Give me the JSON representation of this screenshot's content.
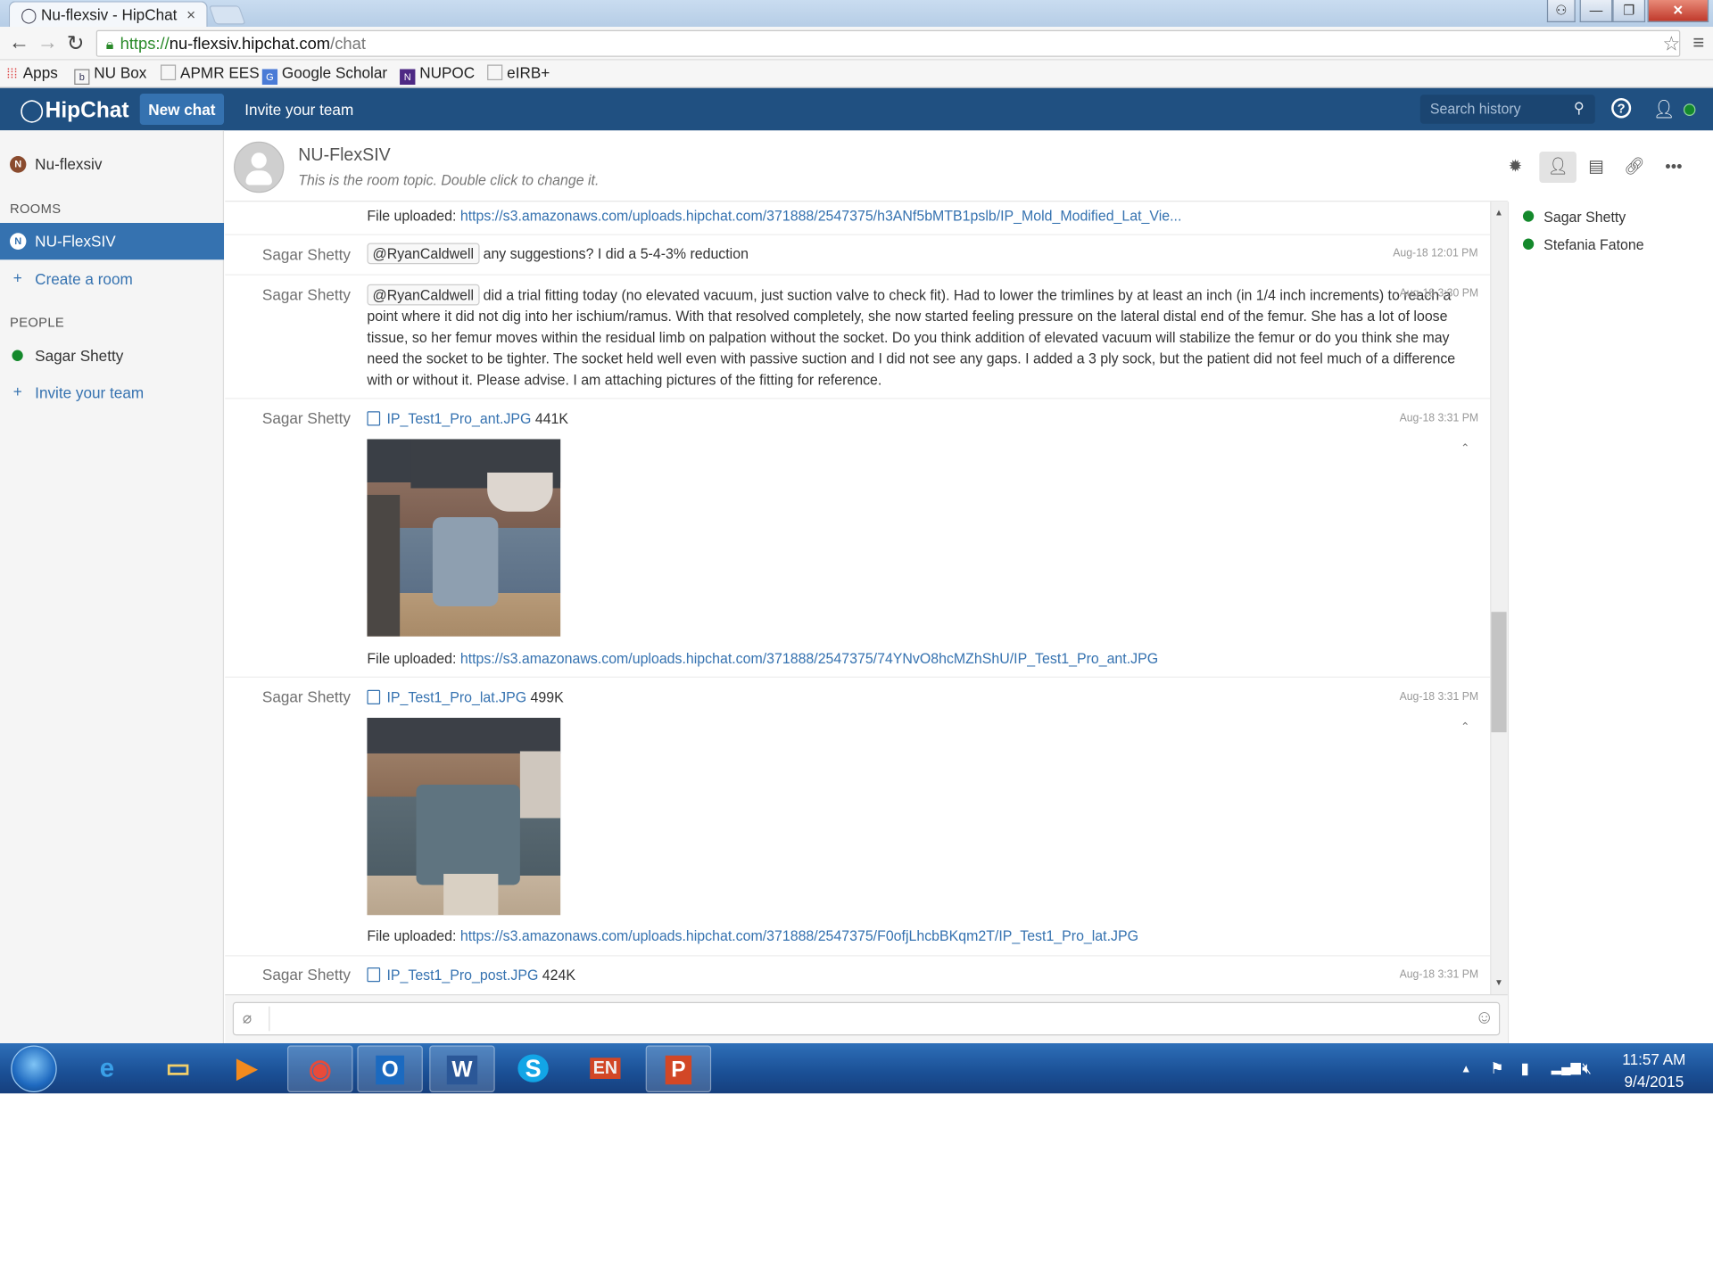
{
  "browser": {
    "tab_title": "Nu-flexsiv - HipChat",
    "url_scheme": "https://",
    "url_host": "nu-flexsiv.hipchat.com",
    "url_path": "/chat",
    "bookmarks": [
      "Apps",
      "NU Box",
      "APMR EES",
      "Google Scholar",
      "NUPOC",
      "eIRB+"
    ]
  },
  "header": {
    "logo": "HipChat",
    "new_chat": "New chat",
    "invite": "Invite your team",
    "search_placeholder": "Search history"
  },
  "sidebar": {
    "group_name": "Nu-flexsiv",
    "rooms_heading": "ROOMS",
    "active_room": "NU-FlexSIV",
    "create_room": "Create a room",
    "people_heading": "PEOPLE",
    "person": "Sagar Shetty",
    "invite_team": "Invite your team"
  },
  "room": {
    "title": "NU-FlexSIV",
    "topic": "This is the room topic. Double click to change it."
  },
  "messages": {
    "m0": {
      "prefix": "File uploaded: ",
      "link": "https://s3.amazonaws.com/uploads.hipchat.com/371888/2547375/h3ANf5bMTB1pslb/IP_Mold_Modified_Lat_Vie..."
    },
    "m1": {
      "sender": "Sagar Shetty",
      "mention": "@RyanCaldwell",
      "text": " any suggestions? I did a 5-4-3% reduction",
      "time": "Aug-18 12:01 PM"
    },
    "m2": {
      "sender": "Sagar Shetty",
      "mention": "@RyanCaldwell",
      "text": " did a trial fitting today (no elevated vacuum, just suction valve to check fit). Had to lower the trimlines by at least an inch (in 1/4 inch increments) to reach a point where it did not dig into her ischium/ramus. With that resolved completely, she now started feeling pressure on the lateral distal end of the femur. She has a lot of loose tissue, so her femur moves within the residual limb on palpation without the socket. Do you think addition of elevated vacuum will stabilize the femur or do you think she may need the socket to be tighter. The socket held well even with passive suction and I did not see any gaps. I added a 3 ply sock, but the patient did not feel much of a difference with or without it. Please advise. I am attaching pictures of the fitting for reference.",
      "time": "Aug-18 3:30 PM"
    },
    "m3": {
      "sender": "Sagar Shetty",
      "file_name": "IP_Test1_Pro_ant.JPG",
      "file_size": "441K",
      "time": "Aug-18 3:31 PM",
      "upload_prefix": "File uploaded: ",
      "upload_link": "https://s3.amazonaws.com/uploads.hipchat.com/371888/2547375/74YNvO8hcMZhShU/IP_Test1_Pro_ant.JPG"
    },
    "m4": {
      "sender": "Sagar Shetty",
      "file_name": "IP_Test1_Pro_lat.JPG",
      "file_size": "499K",
      "time": "Aug-18 3:31 PM",
      "upload_prefix": "File uploaded: ",
      "upload_link": "https://s3.amazonaws.com/uploads.hipchat.com/371888/2547375/F0ofjLhcbBKqm2T/IP_Test1_Pro_lat.JPG"
    },
    "m5": {
      "sender": "Sagar Shetty",
      "file_name": "IP_Test1_Pro_post.JPG",
      "file_size": "424K",
      "time": "Aug-18 3:31 PM"
    }
  },
  "roster": [
    "Sagar Shetty",
    "Stefania Fatone"
  ],
  "taskbar": {
    "time": "11:57 AM",
    "date": "9/4/2015"
  }
}
